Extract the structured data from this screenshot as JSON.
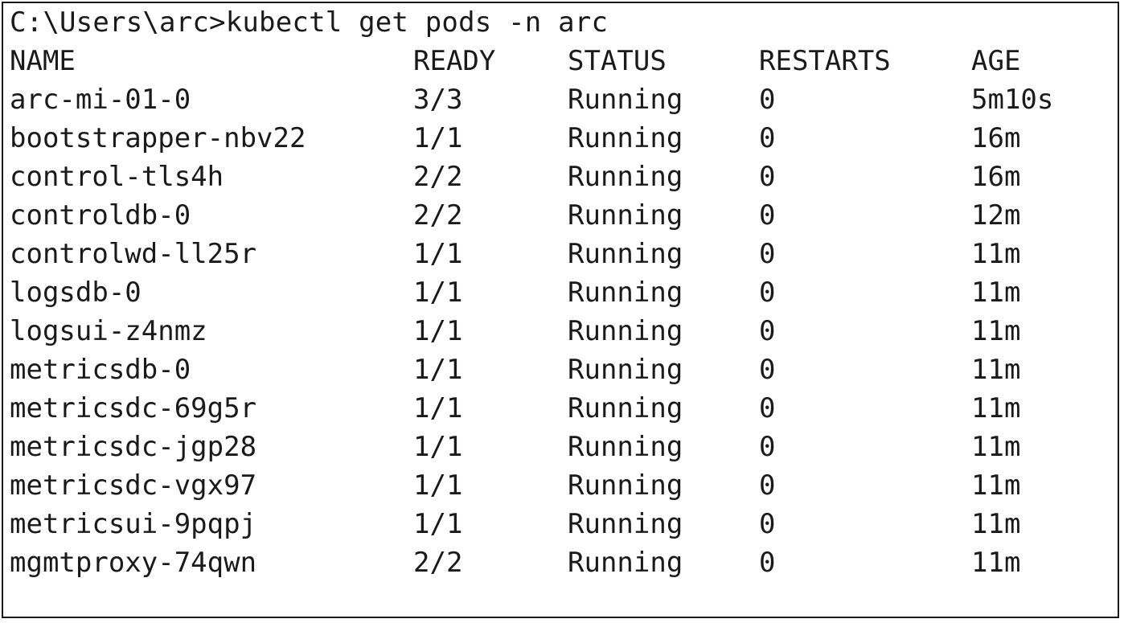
{
  "terminal": {
    "prompt": "C:\\Users\\arc>",
    "command": "kubectl get pods -n arc",
    "headers": {
      "name": "NAME",
      "ready": "READY",
      "status": "STATUS",
      "restarts": "RESTARTS",
      "age": "AGE"
    },
    "pods": [
      {
        "name": "arc-mi-01-0",
        "ready": "3/3",
        "status": "Running",
        "restarts": "0",
        "age": "5m10s"
      },
      {
        "name": "bootstrapper-nbv22",
        "ready": "1/1",
        "status": "Running",
        "restarts": "0",
        "age": "16m"
      },
      {
        "name": "control-tls4h",
        "ready": "2/2",
        "status": "Running",
        "restarts": "0",
        "age": "16m"
      },
      {
        "name": "controldb-0",
        "ready": "2/2",
        "status": "Running",
        "restarts": "0",
        "age": "12m"
      },
      {
        "name": "controlwd-ll25r",
        "ready": "1/1",
        "status": "Running",
        "restarts": "0",
        "age": "11m"
      },
      {
        "name": "logsdb-0",
        "ready": "1/1",
        "status": "Running",
        "restarts": "0",
        "age": "11m"
      },
      {
        "name": "logsui-z4nmz",
        "ready": "1/1",
        "status": "Running",
        "restarts": "0",
        "age": "11m"
      },
      {
        "name": "metricsdb-0",
        "ready": "1/1",
        "status": "Running",
        "restarts": "0",
        "age": "11m"
      },
      {
        "name": "metricsdc-69g5r",
        "ready": "1/1",
        "status": "Running",
        "restarts": "0",
        "age": "11m"
      },
      {
        "name": "metricsdc-jgp28",
        "ready": "1/1",
        "status": "Running",
        "restarts": "0",
        "age": "11m"
      },
      {
        "name": "metricsdc-vgx97",
        "ready": "1/1",
        "status": "Running",
        "restarts": "0",
        "age": "11m"
      },
      {
        "name": "metricsui-9pqpj",
        "ready": "1/1",
        "status": "Running",
        "restarts": "0",
        "age": "11m"
      },
      {
        "name": "mgmtproxy-74qwn",
        "ready": "2/2",
        "status": "Running",
        "restarts": "0",
        "age": "11m"
      }
    ]
  }
}
